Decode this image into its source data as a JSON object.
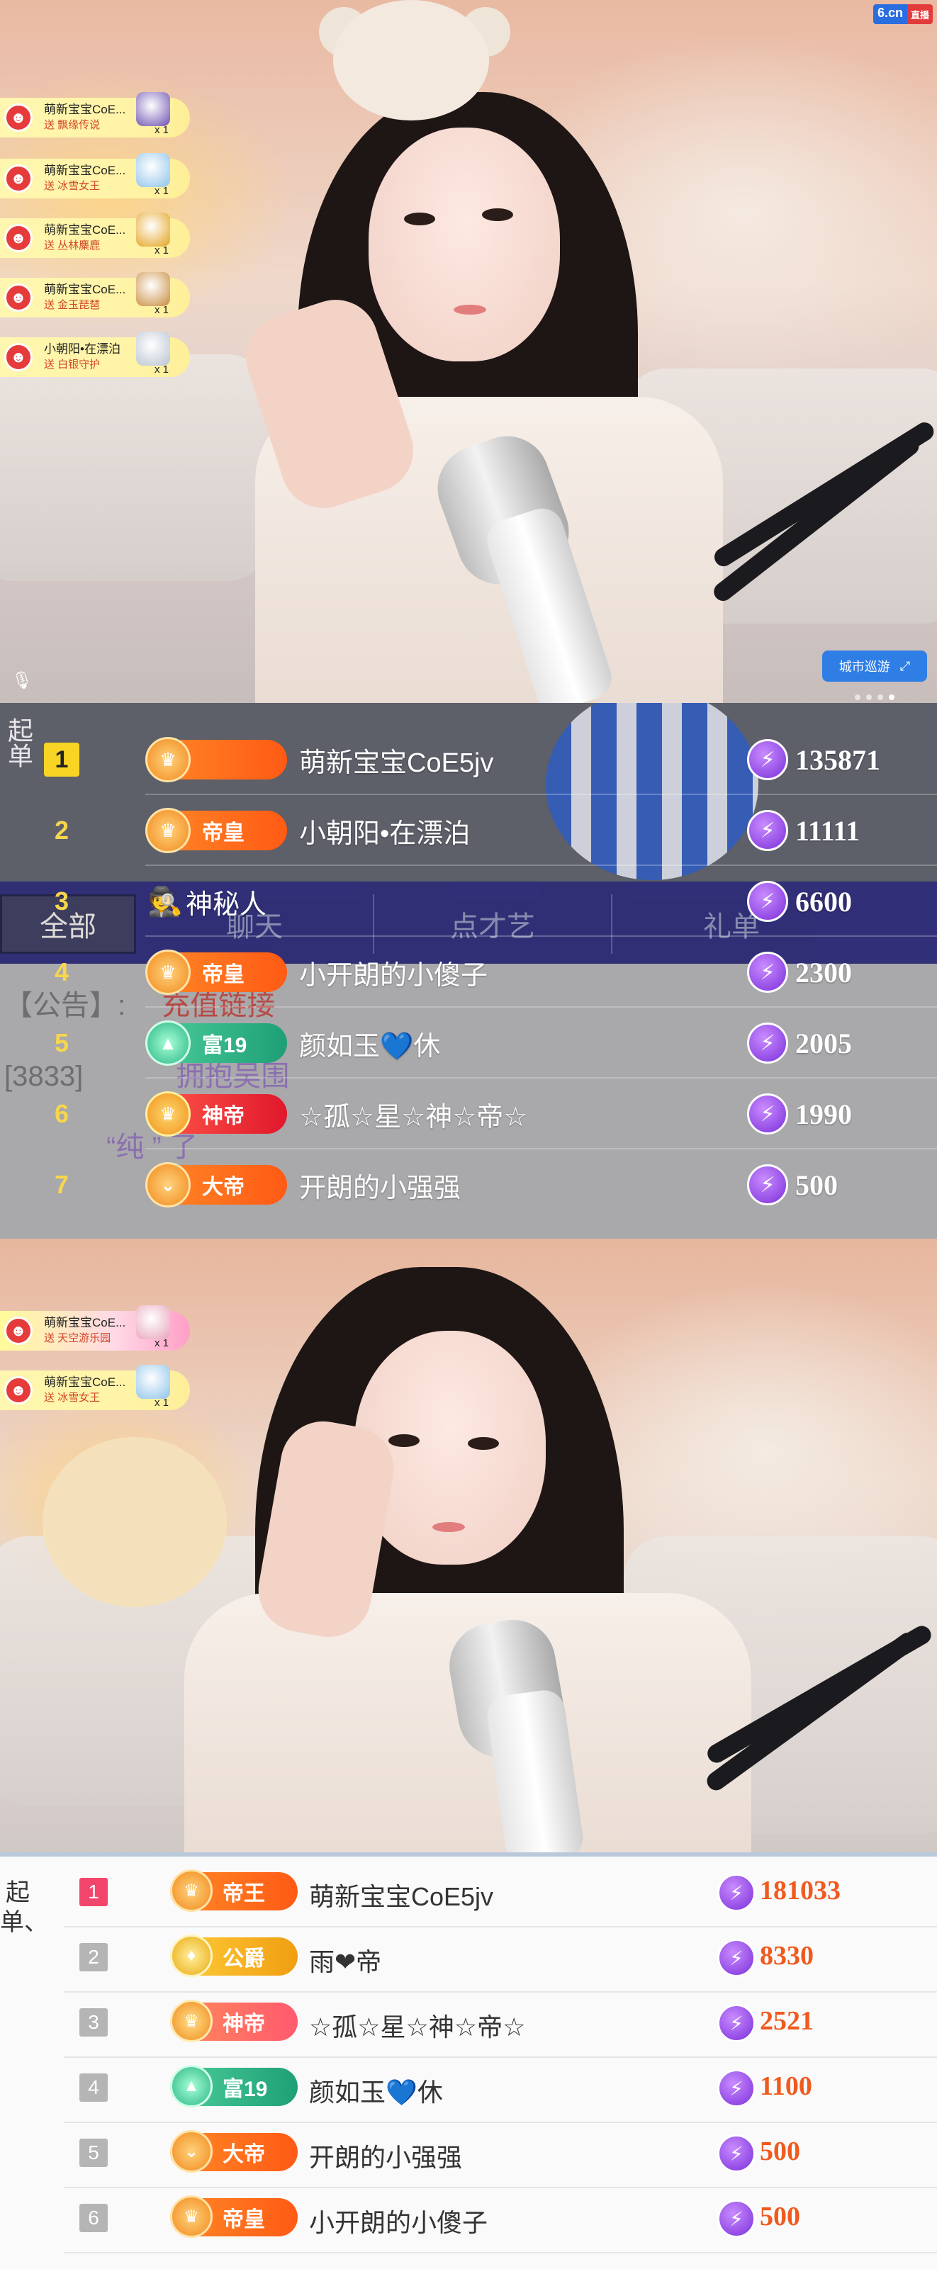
{
  "logo": {
    "site": "6.cn",
    "tag": "直播"
  },
  "top_video": {
    "gift_feed": [
      {
        "user": "萌新宝宝CoE...",
        "gift": "送 飘缘传说",
        "count": "x 1",
        "gift_color": "#6b4fb0"
      },
      {
        "user": "萌新宝宝CoE...",
        "gift": "送 冰雪女王",
        "count": "x 1",
        "gift_color": "#8ec3ea"
      },
      {
        "user": "萌新宝宝CoE...",
        "gift": "送 丛林麋鹿",
        "count": "x 1",
        "gift_color": "#e3a21d"
      },
      {
        "user": "萌新宝宝CoE...",
        "gift": "送 金玉琵琶",
        "count": "x 1",
        "gift_color": "#c98a3c"
      },
      {
        "user": "小朝阳•在漂泊",
        "gift": "送 白银守护",
        "count": "x 1",
        "gift_color": "#b9c3d1"
      }
    ],
    "city_button": "城市巡游",
    "city_icon": "expand-icon"
  },
  "rank_top": {
    "left_side_text": "起单",
    "tabs": [
      "全部",
      "聊天",
      "点才艺",
      "礼单"
    ],
    "chat_lines": [
      {
        "prefix": "【公告】:",
        "text": "充值链接"
      },
      {
        "prefix": "[3833]",
        "text": "拥抱吴围"
      },
      {
        "prefix": "",
        "text": "“纯  ”  了"
      }
    ],
    "rows": [
      {
        "rank": "1",
        "level": "",
        "level_style": "orange",
        "medal": "♛",
        "name": "萌新宝宝CoE5jv",
        "value": "135871"
      },
      {
        "rank": "2",
        "level": "帝皇",
        "level_style": "orange",
        "medal": "♛",
        "name": "小朝阳•在漂泊",
        "value": "11111"
      },
      {
        "rank": "3",
        "level": "",
        "level_style": "none",
        "medal": "",
        "name": "神秘人",
        "value": "6600"
      },
      {
        "rank": "4",
        "level": "帝皇",
        "level_style": "orange",
        "medal": "♛",
        "name": "小开朗的小傻子",
        "value": "2300"
      },
      {
        "rank": "5",
        "level": "富19",
        "level_style": "green",
        "medal": "▲",
        "name": "颜如玉💙休",
        "value": "2005"
      },
      {
        "rank": "6",
        "level": "神帝",
        "level_style": "red",
        "medal": "♛",
        "name": "☆孤☆星☆神☆帝☆",
        "value": "1990"
      },
      {
        "rank": "7",
        "level": "大帝",
        "level_style": "orange",
        "medal": "⌄",
        "name": "开朗的小强强",
        "value": "500"
      }
    ]
  },
  "bottom_video": {
    "gift_feed": [
      {
        "user": "萌新宝宝CoE...",
        "gift": "送 天空游乐园",
        "count": "x 1",
        "gift_color": "#e7a3b9",
        "style": "pink"
      },
      {
        "user": "萌新宝宝CoE...",
        "gift": "送 冰雪女王",
        "count": "x 1",
        "gift_color": "#8ec3ea",
        "style": "yellow"
      }
    ]
  },
  "rank_bottom": {
    "side_text": "起单、",
    "rows": [
      {
        "rank": "1",
        "level": "帝王",
        "level_style": "orange",
        "medal": "♛",
        "name": "萌新宝宝CoE5jv",
        "value": "181033"
      },
      {
        "rank": "2",
        "level": "公爵",
        "level_style": "gold",
        "medal": "♦",
        "name": "雨❤帝",
        "value": "8330"
      },
      {
        "rank": "3",
        "level": "神帝",
        "level_style": "pink",
        "medal": "♛",
        "name": "☆孤☆星☆神☆帝☆",
        "value": "2521"
      },
      {
        "rank": "4",
        "level": "富19",
        "level_style": "green",
        "medal": "▲",
        "name": "颜如玉💙休",
        "value": "1100"
      },
      {
        "rank": "5",
        "level": "大帝",
        "level_style": "orange",
        "medal": "⌄",
        "name": "开朗的小强强",
        "value": "500"
      },
      {
        "rank": "6",
        "level": "帝皇",
        "level_style": "orange",
        "medal": "♛",
        "name": "小开朗的小傻子",
        "value": "500"
      }
    ]
  }
}
